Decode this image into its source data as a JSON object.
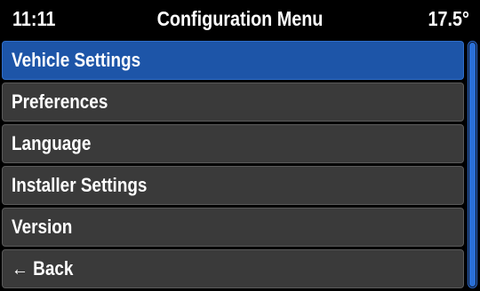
{
  "status_bar": {
    "time": "11:11",
    "title": "Configuration Menu",
    "temperature": "17.5°"
  },
  "menu": {
    "items": [
      {
        "label": "Vehicle Settings",
        "selected": true
      },
      {
        "label": "Preferences",
        "selected": false
      },
      {
        "label": "Language",
        "selected": false
      },
      {
        "label": "Installer Settings",
        "selected": false
      },
      {
        "label": "Version",
        "selected": false
      },
      {
        "label": "← Back",
        "selected": false
      }
    ]
  },
  "colors": {
    "background": "#000000",
    "item_background": "#3a3a3a",
    "selected_background": "#1d55a8",
    "scrollbar_accent": "#2a6fd6",
    "text": "#ffffff"
  }
}
